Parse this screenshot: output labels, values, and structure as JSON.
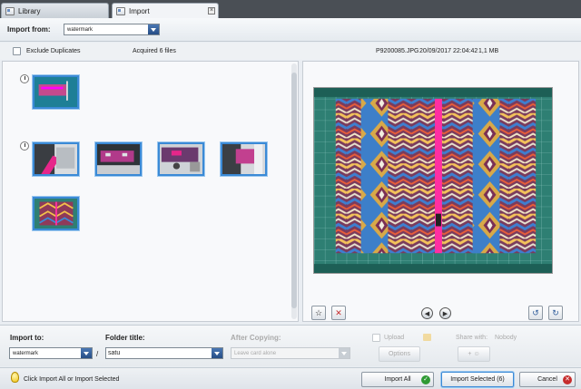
{
  "tabs": [
    {
      "label": "Library",
      "active": false
    },
    {
      "label": "Import",
      "active": true
    }
  ],
  "import_from": {
    "label": "Import from:",
    "value": "watermark"
  },
  "options": {
    "exclude_duplicates_label": "Exclude Duplicates",
    "exclude_duplicates_checked": false,
    "acquired_text": "Acquired 6 files"
  },
  "file_info": {
    "name": "P9200085.JPG",
    "datetime": "20/09/2017 22:04:42",
    "size": "1,1 MB"
  },
  "thumb_groups": [
    {
      "count": 1
    },
    {
      "count": 5
    }
  ],
  "import_to": {
    "label": "Import to:",
    "value": "watermark"
  },
  "folder": {
    "separator": "/",
    "label": "Folder title:",
    "value": "satu"
  },
  "after_copying": {
    "label": "After Copying:",
    "value": "Leave card alone"
  },
  "upload": {
    "label": "Upload",
    "options_label": "Options",
    "share_label": "Share with:",
    "share_value": "Nobody"
  },
  "buttons": {
    "import_all": "Import All",
    "import_selected": "Import Selected (6)",
    "cancel": "Cancel"
  },
  "status": {
    "hint": "Click Import All or Import Selected"
  },
  "colors": {
    "accent": "#3b8ad6",
    "dropdown": "#2b5a99",
    "ok": "#2f9a34",
    "cancel": "#c62c2c",
    "mat": "#2e7f73"
  }
}
